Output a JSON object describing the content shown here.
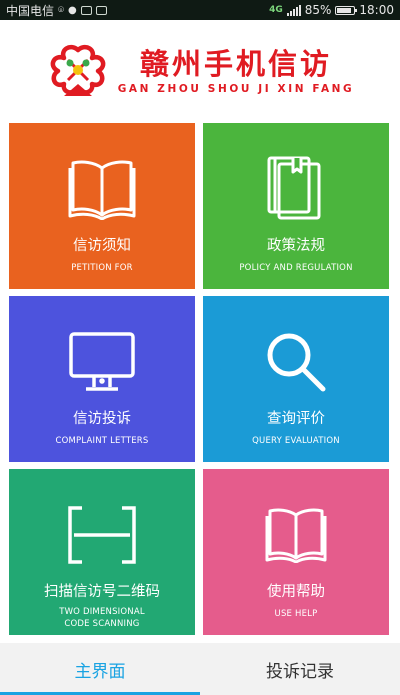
{
  "status_bar": {
    "carrier": "中国电信",
    "network": "4G",
    "battery": "85%",
    "time": "18:00"
  },
  "header": {
    "title_cn": "赣州手机信访",
    "title_en": "GAN ZHOU SHOU JI XIN FANG",
    "logo_icon": "gz-petition-logo"
  },
  "tiles": [
    {
      "cn": "信访须知",
      "en": "PETITION FOR",
      "icon": "open-book-icon",
      "color": "#e9621f"
    },
    {
      "cn": "政策法规",
      "en": "POLICY AND REGULATION",
      "icon": "law-books-icon",
      "color": "#4bb53d"
    },
    {
      "cn": "信访投诉",
      "en": "COMPLAINT LETTERS",
      "icon": "monitor-icon",
      "color": "#4d53dd"
    },
    {
      "cn": "查询评价",
      "en": "QUERY EVALUATION",
      "icon": "search-icon",
      "color": "#1b9bd6"
    },
    {
      "cn": "扫描信访号二维码",
      "en_lines": [
        "TWO DIMENSIONAL",
        "CODE SCANNING"
      ],
      "icon": "scan-icon",
      "color": "#22a873"
    },
    {
      "cn": "使用帮助",
      "en": "USE HELP",
      "icon": "help-book-icon",
      "color": "#e55c8c"
    }
  ],
  "tabs": [
    {
      "label": "主界面",
      "active": true
    },
    {
      "label": "投诉记录",
      "active": false
    }
  ],
  "accent_color": "#1aa3e2",
  "brand_color": "#e01b22"
}
